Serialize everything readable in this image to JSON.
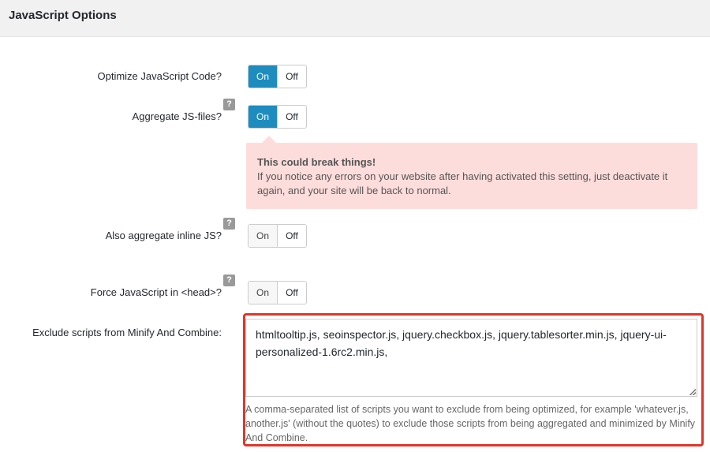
{
  "panel": {
    "title": "JavaScript Options"
  },
  "rows": {
    "optimize": {
      "label": "Optimize JavaScript Code?",
      "on": "On",
      "off": "Off",
      "value": "On"
    },
    "aggregate": {
      "label": "Aggregate JS-files?",
      "help": "?",
      "on": "On",
      "off": "Off",
      "value": "On"
    },
    "inline": {
      "label": "Also aggregate inline JS?",
      "help": "?",
      "on": "On",
      "off": "Off",
      "value": "Off"
    },
    "force_head": {
      "label": "Force JavaScript in <head>?",
      "help": "?",
      "on": "On",
      "off": "Off",
      "value": "Off"
    },
    "exclude": {
      "label": "Exclude scripts from Minify And Combine:",
      "value": "htmltooltip.js, seoinspector.js, jquery.checkbox.js, jquery.tablesorter.min.js, jquery-ui-personalized-1.6rc2.min.js,",
      "description": "A comma-separated list of scripts you want to exclude from being optimized, for example 'whatever.js, another.js' (without the quotes) to exclude those scripts from being aggregated and minimized by Minify And Combine."
    }
  },
  "warning": {
    "title": "This could break things!",
    "text": "If you notice any errors on your website after having activated this setting, just deactivate it again, and your site will be back to normal."
  },
  "colors": {
    "accent": "#1e8cbe",
    "warning_bg": "#fddddb",
    "highlight": "#e0362a"
  }
}
